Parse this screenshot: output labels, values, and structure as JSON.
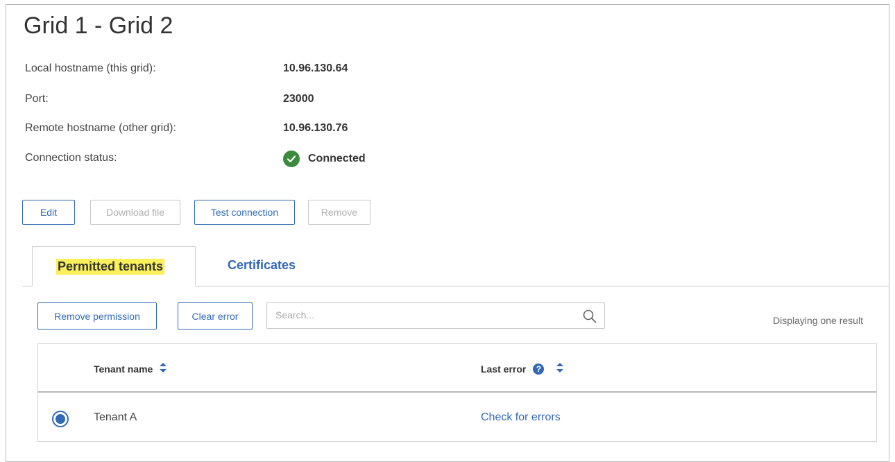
{
  "page": {
    "title": "Grid 1 - Grid 2"
  },
  "info": {
    "local_hostname_label": "Local hostname (this grid):",
    "local_hostname_value": "10.96.130.64",
    "port_label": "Port:",
    "port_value": "23000",
    "remote_hostname_label": "Remote hostname (other grid):",
    "remote_hostname_value": "10.96.130.76",
    "status_label": "Connection status:",
    "status_value": "Connected"
  },
  "actions": {
    "edit": "Edit",
    "download": "Download file",
    "test": "Test connection",
    "remove": "Remove"
  },
  "tabs": [
    {
      "label": "Permitted tenants",
      "active": true
    },
    {
      "label": "Certificates",
      "active": false
    }
  ],
  "toolbar": {
    "remove_permission": "Remove permission",
    "clear_error": "Clear error",
    "search_placeholder": "Search...",
    "result_count": "Displaying one result"
  },
  "table": {
    "columns": [
      "Tenant name",
      "Last error"
    ],
    "rows": [
      {
        "tenant_name": "Tenant A",
        "last_error": "Check for errors",
        "selected": true
      }
    ]
  },
  "colors": {
    "accent": "#3268b5",
    "success": "#3b8a3e",
    "highlight": "#fbf05a"
  },
  "icons": {
    "status": "check-circle-icon",
    "search": "search-icon",
    "sort": "sort-icon",
    "help": "question-circle-icon"
  }
}
